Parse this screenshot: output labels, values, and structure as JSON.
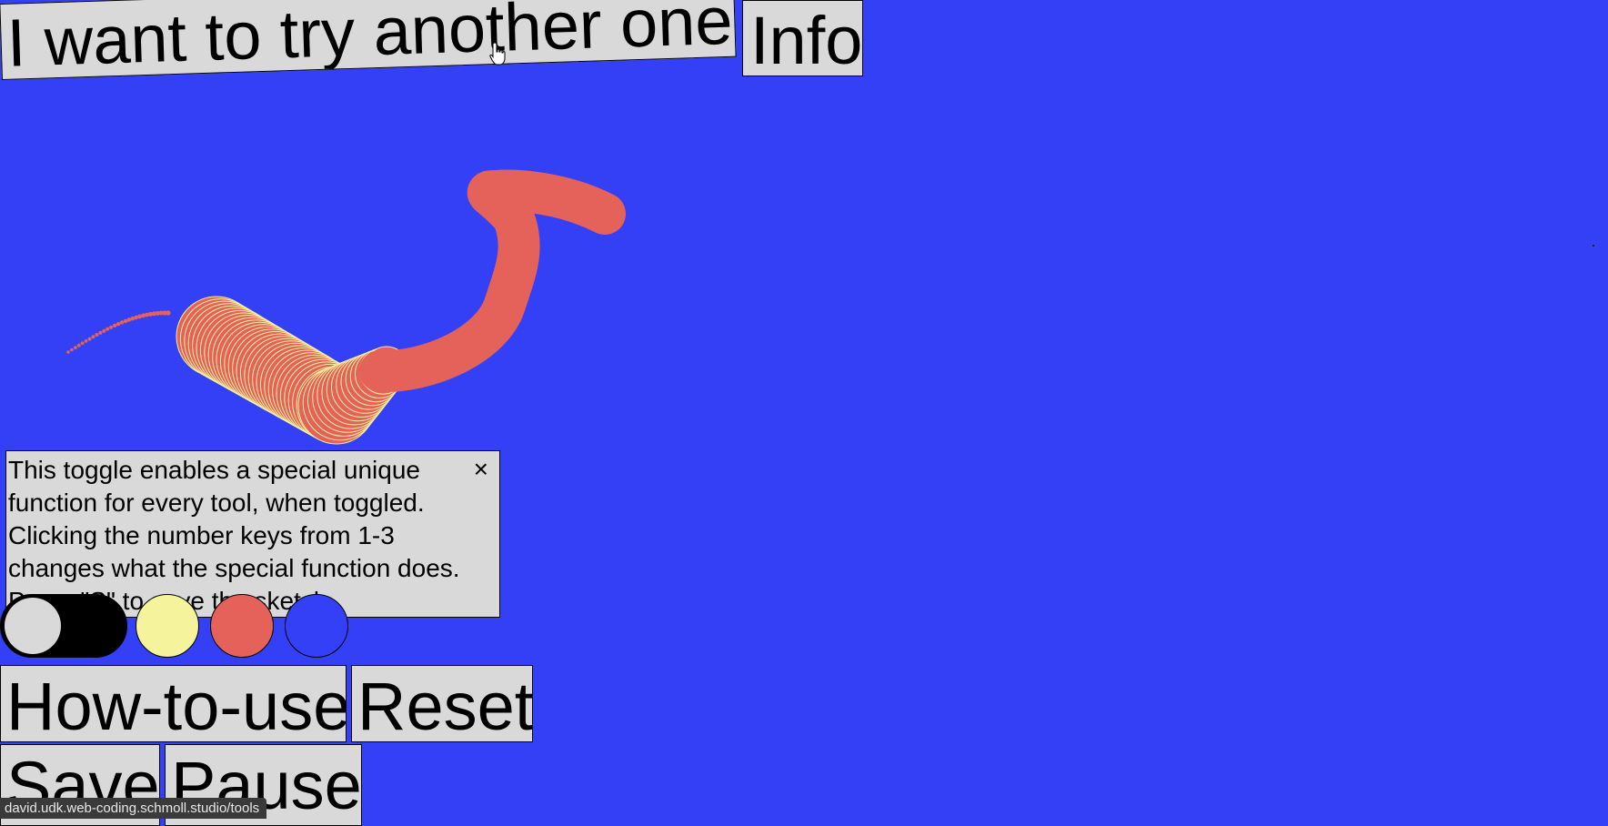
{
  "buttons": {
    "try_another": "I want to try another one!",
    "info": "Info",
    "how_to_use": "How-to-use",
    "reset": "Reset",
    "save": "Save",
    "pause": "Pause"
  },
  "tooltip": {
    "text": "This toggle enables a special unique function for every tool, when toggled. Clicking the number keys from 1-3 changes what the special function does. Press \"S\" to save the sketch.",
    "close": "×"
  },
  "palette": {
    "toggle_on": true,
    "colors": [
      "#f5f39c",
      "#e4625a",
      "#3440f6"
    ]
  },
  "colors": {
    "background": "#3440f6",
    "button": "#d9d9d9",
    "stroke": "#e4625a",
    "highlight": "#f5f39c"
  },
  "status_bar": {
    "url": "david.udk.web-coding.schmoll.studio/tools"
  },
  "icons": {
    "cursor": "hand-pointer-icon",
    "close": "close-icon"
  }
}
